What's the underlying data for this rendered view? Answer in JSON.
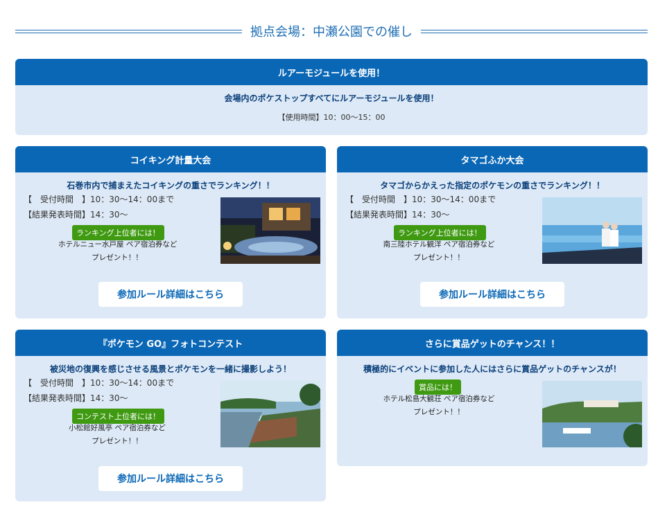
{
  "section": {
    "title": "拠点会場：中瀬公園での催し"
  },
  "lure": {
    "heading": "ルアーモジュールを使用！",
    "lead": "会場内のポケストップすべてにルアーモジュールを使用！",
    "time": "【使用時間】10：00～15：00"
  },
  "koiking": {
    "heading": "コイキング計量大会",
    "lead": "石巻市内で捕まえたコイキングの重さでランキング！！",
    "reception": "【　受付時間　】10：30～14：00まで",
    "result": "【結果発表時間】14：30～",
    "badge": "ランキング上位者には！",
    "prize1": "ホテルニュー水戸屋 ペア宿泊券など",
    "prize2": "プレゼント！！",
    "button": "参加ルール詳細はこちら"
  },
  "tamago": {
    "heading": "タマゴふか大会",
    "lead": "タマゴからかえった指定のポケモンの重さでランキング！！",
    "reception": "【　受付時間　】10：30～14：00まで",
    "result": "【結果発表時間】14：30～",
    "badge": "ランキング上位者には！",
    "prize1": "南三陸ホテル観洋 ペア宿泊券など",
    "prize2": "プレゼント！！",
    "button": "参加ルール詳細はこちら"
  },
  "photo_contest": {
    "heading": "『ポケモン GO』フォトコンテスト",
    "lead": "被災地の復興を感じさせる風景とポケモンを一緒に撮影しよう！",
    "reception": "【　受付時間　】10：30～14：00まで",
    "result": "【結果発表時間】14：30～",
    "badge": "コンテスト上位者には！",
    "prize1": "小松館好風亭 ペア宿泊券など",
    "prize2": "プレゼント！！",
    "button": "参加ルール詳細はこちら"
  },
  "chance": {
    "heading": "さらに賞品ゲットのチャンス！！",
    "lead": "積極的にイベントに参加した人にはさらに賞品ゲットのチャンスが！",
    "badge": "賞品には！",
    "prize1": "ホテル松島大観荘 ペア宿泊券など",
    "prize2": "プレゼント！！"
  },
  "colors": {
    "header_blue": "#0a67b6",
    "card_bg": "#dde9f6",
    "badge_green": "#3f9a12",
    "title_blue": "#1f6fb5"
  }
}
